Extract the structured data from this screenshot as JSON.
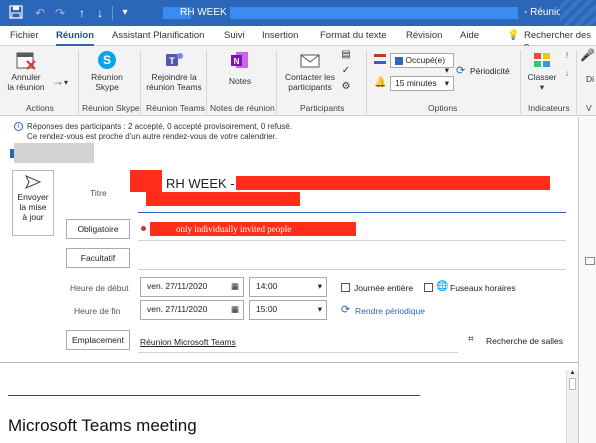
{
  "window": {
    "title_fragment": "RH WEEK - R",
    "right_title": "- Réunion"
  },
  "tabs": [
    "Fichier",
    "Réunion",
    "Assistant Planification",
    "Suivi",
    "Insertion",
    "Format du texte",
    "Révision",
    "Aide",
    "Rechercher des o"
  ],
  "ribbon": {
    "cancel_label_1": "Annuler",
    "cancel_label_2": "la réunion",
    "skype_label_1": "Réunion",
    "skype_label_2": "Skype",
    "teams_label_1": "Rejoindre la",
    "teams_label_2": "réunion Teams",
    "notes_label": "Notes",
    "contact_label_1": "Contacter les",
    "contact_label_2": "participants",
    "show_as": "Occupé(e)",
    "reminder": "15 minutes",
    "recurrence": "Périodicité",
    "classify": "Classer",
    "dictate": "Di",
    "groups": {
      "actions": "Actions",
      "skype": "Réunion Skype",
      "teams": "Réunion Teams",
      "notes": "Notes de réunion",
      "participants": "Participants",
      "options": "Options",
      "indicators": "Indicateurs",
      "more": "V"
    }
  },
  "infobar": {
    "line1": "Réponses des participants : 2 accepté, 0 accepté provisoirement, 0 refusé.",
    "line2": "Ce rendez-vous est proche d'un autre rendez-vous de votre calendrier."
  },
  "form": {
    "send_1": "Envoyer",
    "send_2": "la mise",
    "send_3": "à jour",
    "title_label": "Titre",
    "subject_visible": "RH WEEK -",
    "required_button": "Obligatoire",
    "required_note": "only individually invited people",
    "optional_button": "Facultatif",
    "start_label": "Heure de début",
    "end_label": "Heure de fin",
    "start_date": "ven. 27/11/2020",
    "start_time": "14:00",
    "end_date": "ven. 27/11/2020",
    "end_time": "15:00",
    "all_day": "Journée entière",
    "time_zones": "Fuseaux horaires",
    "make_recurring": "Rendre périodique",
    "location_button": "Emplacement",
    "location_value": "Réunion Microsoft Teams",
    "room_finder": "Recherche de salles"
  },
  "body": {
    "heading": "Microsoft Teams meeting"
  },
  "colors": {
    "accent": "#2b66b8",
    "redaction": "#ff2d1a"
  }
}
